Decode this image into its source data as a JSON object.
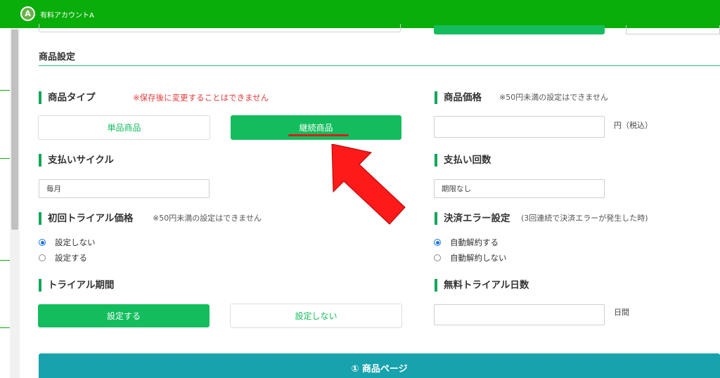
{
  "header": {
    "avatar_letter": "A",
    "account_name": "有料アカウントA",
    "bar_color": "#0aae0a"
  },
  "section": {
    "title": "商品設定"
  },
  "product_type": {
    "label": "商品タイプ",
    "note": "※保存後に変更することはできません",
    "options": [
      "単品商品",
      "継続商品"
    ],
    "selected": "継続商品"
  },
  "price": {
    "label": "商品価格",
    "note": "※50円未満の設定はできません",
    "value": "",
    "unit": "円（税込）"
  },
  "cycle": {
    "label": "支払いサイクル",
    "value": "毎月"
  },
  "count": {
    "label": "支払い回数",
    "value": "期限なし"
  },
  "trial_price": {
    "label": "初回トライアル価格",
    "note": "※50円未満の設定はできません",
    "options": [
      {
        "label": "設定しない",
        "checked": true
      },
      {
        "label": "設定する",
        "checked": false
      }
    ]
  },
  "payment_error": {
    "label": "決済エラー設定",
    "note": "(3回連続で決済エラーが発生した時)",
    "options": [
      {
        "label": "自動解約する",
        "checked": true
      },
      {
        "label": "自動解約しない",
        "checked": false
      }
    ]
  },
  "trial_period": {
    "label": "トライアル期間",
    "options": [
      "設定する",
      "設定しない"
    ],
    "selected": "設定する"
  },
  "trial_days": {
    "label": "無料トライアル日数",
    "value": "",
    "unit": "日間"
  },
  "page_section": {
    "title": "① 商品ページ"
  },
  "colors": {
    "accent": "#13bd5d",
    "banner": "#17a2ad",
    "annotation": "#ff1a1a"
  }
}
